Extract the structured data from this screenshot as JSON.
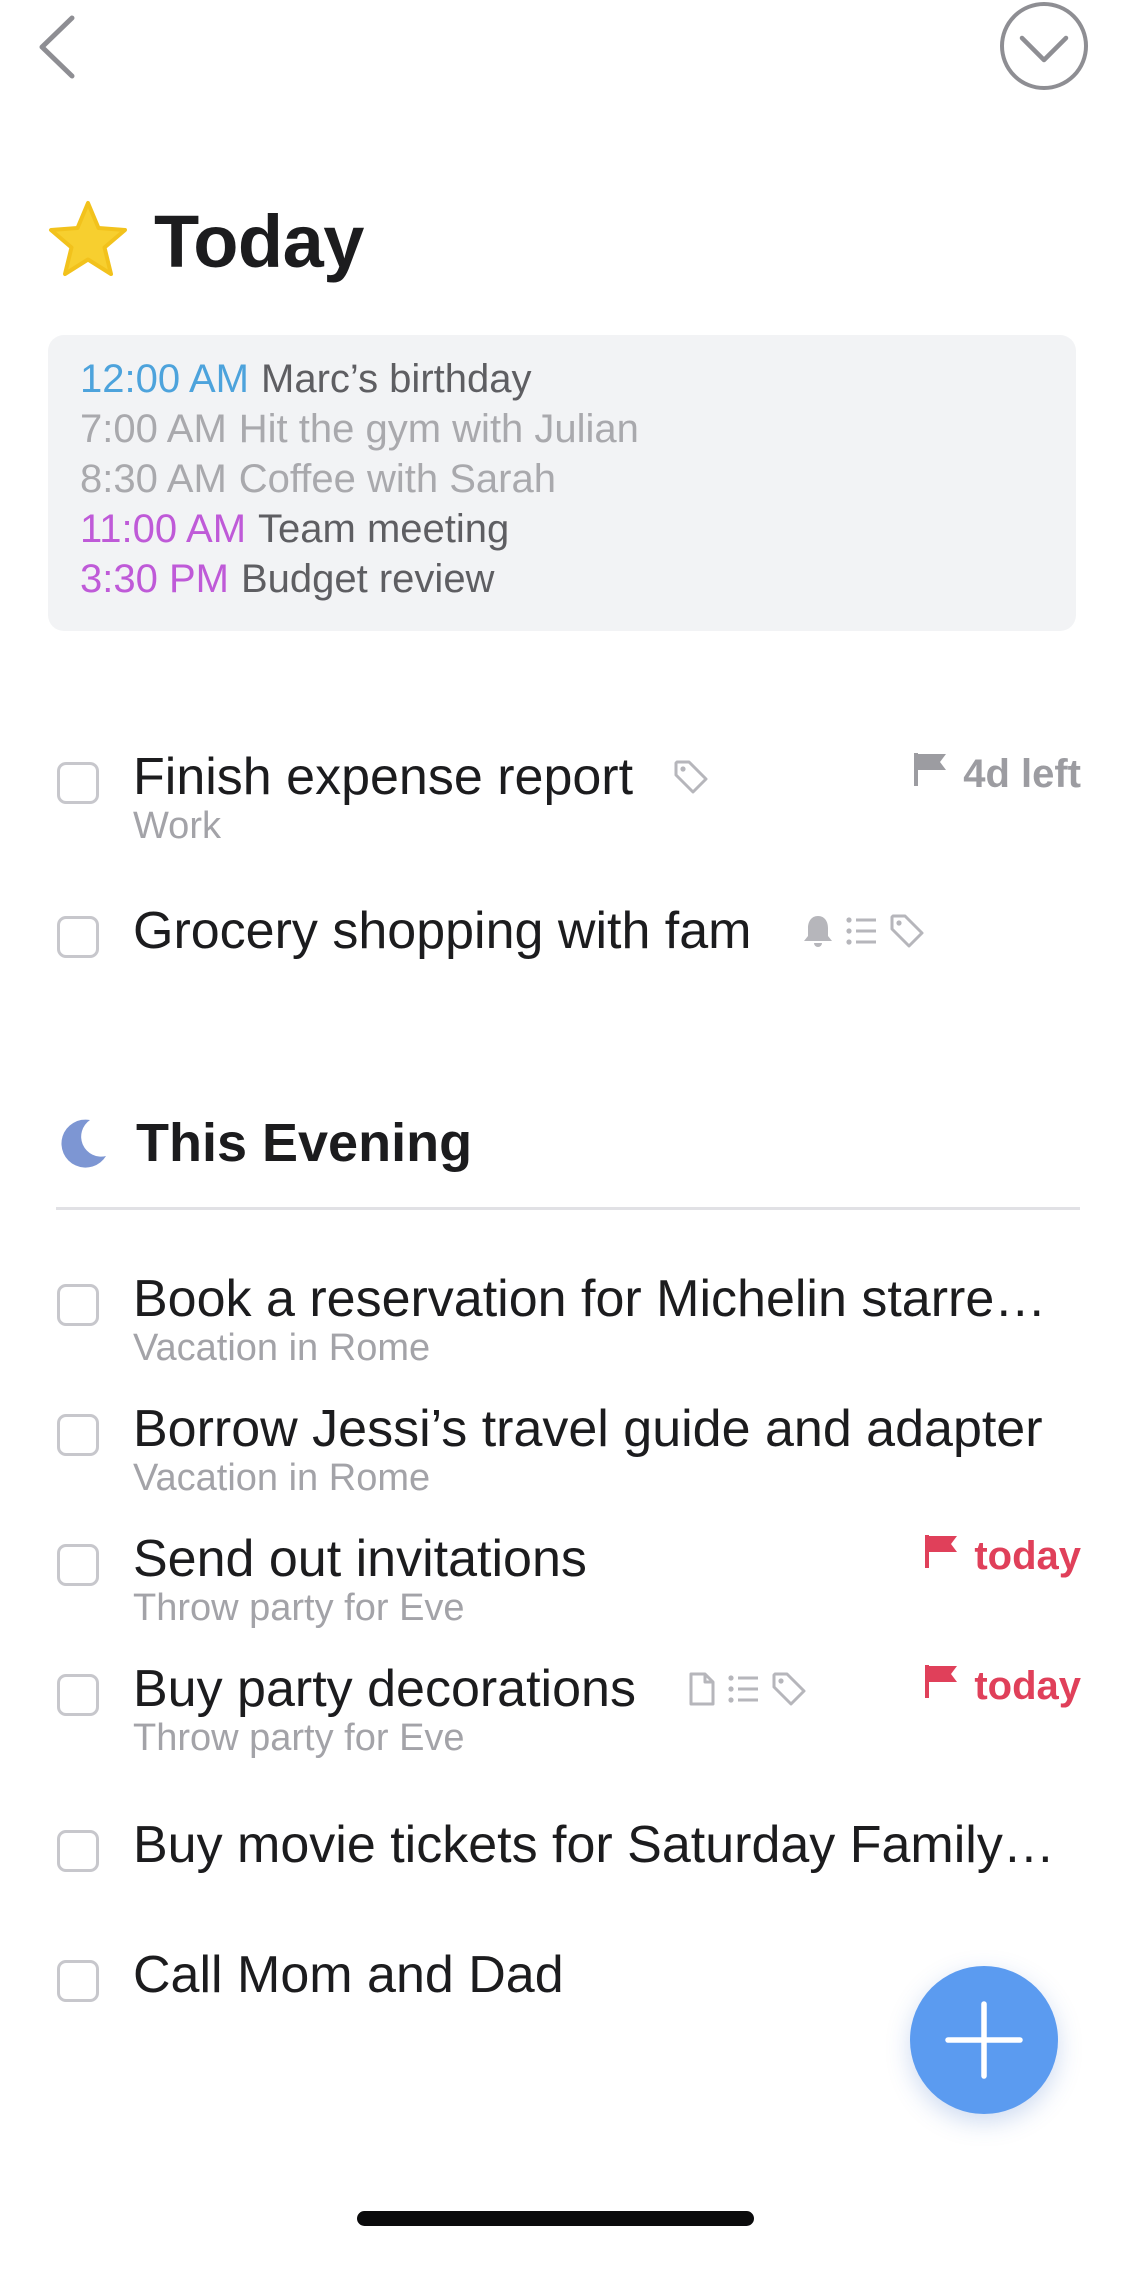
{
  "header": {
    "title": "Today",
    "title_icon": "star-icon",
    "back_icon": "chevron-left-icon",
    "done_icon": "checkmark-circle-icon"
  },
  "calendar_events": [
    {
      "time": "12:00 AM",
      "title": "Marc’s birthday",
      "time_color": "#4da3dc",
      "past": false
    },
    {
      "time": "7:00 AM",
      "title": "Hit the gym with Julian",
      "time_color": "#a9a9ad",
      "past": true
    },
    {
      "time": "8:30 AM",
      "title": "Coffee with Sarah",
      "time_color": "#a9a9ad",
      "past": true
    },
    {
      "time": "11:00 AM",
      "title": "Team meeting",
      "time_color": "#bf5ad8",
      "past": false
    },
    {
      "time": "3:30 PM",
      "title": "Budget review",
      "time_color": "#bf5ad8",
      "past": false
    }
  ],
  "today_tasks": [
    {
      "title": "Finish expense report",
      "subtitle": "Work",
      "icons": [
        "tag-icon"
      ],
      "deadline": "4d left",
      "deadline_color": "#9c9ca1"
    },
    {
      "title": "Grocery shopping with fam",
      "subtitle": "",
      "icons": [
        "bell-icon",
        "checklist-icon",
        "tag-icon"
      ],
      "deadline": ""
    }
  ],
  "evening_section": {
    "title": "This Evening",
    "icon": "moon-icon"
  },
  "evening_tasks": [
    {
      "title": "Book a reservation for Michelin starre…",
      "subtitle": "Vacation in Rome",
      "icons": [],
      "deadline": ""
    },
    {
      "title": "Borrow Jessi’s travel guide and adapter",
      "subtitle": "Vacation in Rome",
      "icons": [],
      "deadline": ""
    },
    {
      "title": "Send out invitations",
      "subtitle": "Throw party for Eve",
      "icons": [],
      "deadline": "today",
      "deadline_color": "#e0405a"
    },
    {
      "title": "Buy party decorations",
      "subtitle": "Throw party for Eve",
      "icons": [
        "note-icon",
        "checklist-icon",
        "tag-icon"
      ],
      "deadline": "today",
      "deadline_color": "#e0405a"
    },
    {
      "title": "Buy movie tickets for Saturday Family…",
      "subtitle": "",
      "icons": [],
      "deadline": ""
    },
    {
      "title": "Call Mom and Dad",
      "subtitle": "",
      "icons": [],
      "deadline": ""
    }
  ],
  "fab": {
    "icon": "plus-icon",
    "color": "#5b9bf0"
  },
  "colors": {
    "accent_blue": "#5b9bf0",
    "deadline_red": "#e0405a",
    "star_yellow": "#f7cf2f",
    "moon_blue": "#7d96d3"
  }
}
